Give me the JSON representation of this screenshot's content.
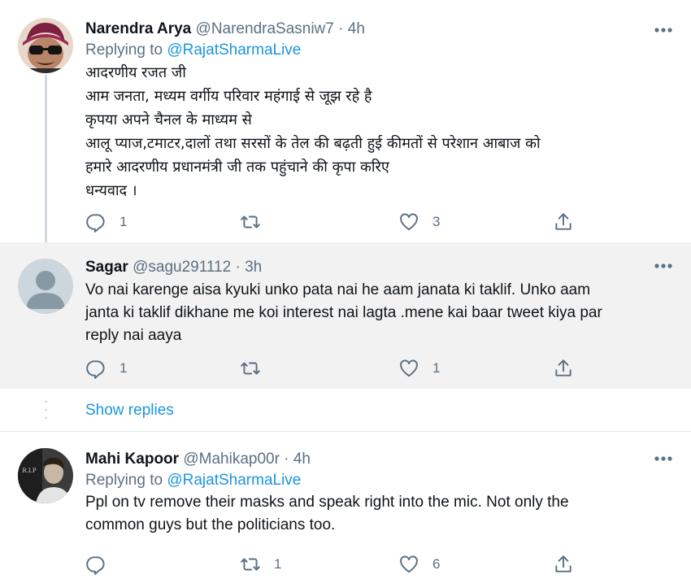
{
  "tweets": [
    {
      "name": "Narendra Arya",
      "handle": "@NarendraSasniw7",
      "time": "4h",
      "dot": "·",
      "replying_prefix": "Replying to",
      "replying_mention": "@RajatSharmaLive",
      "lines": [
        "आदरणीय रजत जी",
        "आम जनता, मध्यम वर्गीय परिवार महंगाई से जूझ रहे है",
        "कृपया अपने चैनल के माध्यम से",
        "आलू प्याज,टमाटर,दालों तथा सरसों के तेल की बढ़ती हुई कीमतों से परेशान आबाज को",
        "हमारे आदरणीय प्रधानमंत्री जी तक पहुंचाने की कृपा करिए",
        "धन्यवाद ।"
      ],
      "reply_count": "1",
      "retweet_count": "",
      "like_count": "3"
    },
    {
      "name": "Sagar",
      "handle": "@sagu291112",
      "time": "3h",
      "dot": "·",
      "lines": [
        "Vo nai karenge aisa kyuki unko pata nai he aam janata ki taklif. Unko aam",
        "janta ki taklif  dikhane me koi interest nai lagta .mene kai baar tweet kiya par",
        "reply nai aaya"
      ],
      "reply_count": "1",
      "retweet_count": "",
      "like_count": "1"
    },
    {
      "name": "Mahi Kapoor",
      "handle": "@Mahikap00r",
      "time": "4h",
      "dot": "·",
      "replying_prefix": "Replying to",
      "replying_mention": "@RajatSharmaLive",
      "lines": [
        "Ppl on tv remove their masks and speak right into the mic. Not only the",
        "common guys but the politicians too."
      ],
      "reply_count": "",
      "retweet_count": "1",
      "like_count": "6"
    }
  ],
  "show_replies_label": "Show replies",
  "avatar_overlay_text": "R.I.P",
  "colors": {
    "link": "#1b95e0",
    "secondary_text": "#5b7083",
    "highlight_bg": "#f2f2f2",
    "thread_line": "#cfd9de"
  },
  "icons": [
    "more-icon",
    "reply-icon",
    "retweet-icon",
    "like-icon",
    "share-icon"
  ]
}
